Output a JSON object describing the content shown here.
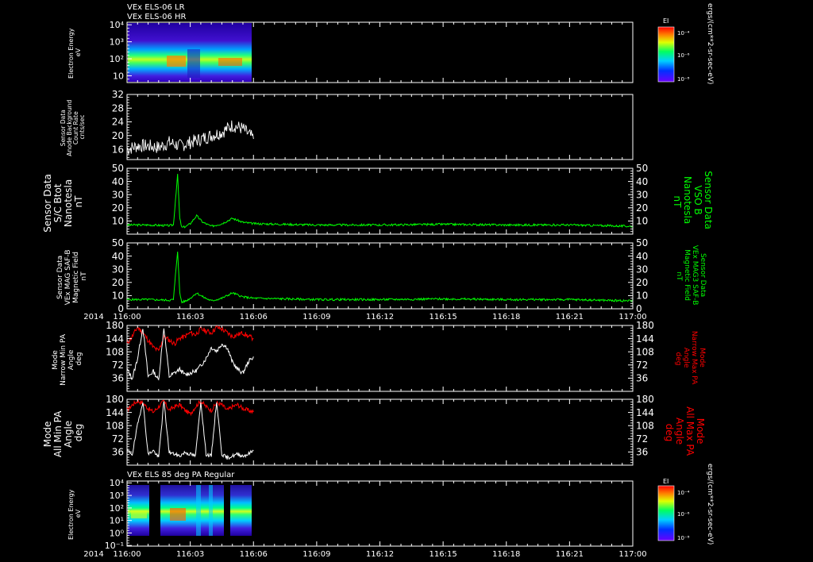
{
  "header": {
    "line1": "VEx ELS-06 LR",
    "line2": "VEx ELS-06 HR"
  },
  "x_axis": {
    "year": "2014",
    "ticks": [
      "116:00",
      "116:03",
      "116:06",
      "116:09",
      "116:12",
      "116:15",
      "116:18",
      "116:21",
      "117:00"
    ]
  },
  "colors": {
    "background": "#000000",
    "white": "#ffffff",
    "green": "#00ff00",
    "red": "#ff0000"
  },
  "colorbar": {
    "label": "EI",
    "units": "ergs/(cm**2-sr-sec-eV)",
    "ticks": [
      "10⁻⁴",
      "10⁻⁶",
      "10⁻⁸"
    ]
  },
  "panels": {
    "spec1": {
      "left_label": [
        "Electron Energy",
        "eV"
      ],
      "yticks": [
        {
          "v": 4,
          "t": "10⁴"
        },
        {
          "v": 3,
          "t": "10³"
        },
        {
          "v": 2,
          "t": "10²"
        },
        {
          "v": 1,
          "t": "10"
        }
      ]
    },
    "bg": {
      "left_label": [
        "Sensor Data",
        "Anode Background",
        "Count Rate",
        "cnts/sec"
      ],
      "yticks": [
        "32",
        "28",
        "24",
        "20",
        "16"
      ]
    },
    "btot": {
      "left_label": [
        "Sensor Data",
        "S/C Btot",
        "Nanotesla",
        "nT"
      ],
      "right_label": [
        "Sensor Data",
        "VSO B",
        "Nanotesla",
        "nT"
      ],
      "yticks": [
        "50",
        "40",
        "30",
        "20",
        "10"
      ],
      "ryticks": [
        "50",
        "40",
        "30",
        "20",
        "10"
      ]
    },
    "mag": {
      "left_label": [
        "Sensor Data",
        "VEx MAG SAF-B",
        "Magnetic Field",
        "nT"
      ],
      "right_label": [
        "Sensor Data",
        "VEx MAG3 SAF-B",
        "Magnetic Field",
        "nT"
      ],
      "yticks": [
        "50",
        "40",
        "30",
        "20",
        "10",
        "0"
      ],
      "ryticks": [
        "50",
        "40",
        "30",
        "20",
        "10",
        "0"
      ]
    },
    "pa1": {
      "left_label": [
        "Mode",
        "Narrow Min PA",
        "Angle",
        "deg"
      ],
      "right_label": [
        "Mode",
        "Narrow Max PA",
        "Angle",
        "deg"
      ],
      "yticks": [
        "180",
        "144",
        "108",
        "72",
        "36"
      ],
      "ryticks": [
        "180",
        "144",
        "108",
        "72",
        "36"
      ]
    },
    "pa2": {
      "left_label": [
        "Mode",
        "All Min PA",
        "Angle",
        "deg"
      ],
      "right_label": [
        "Mode",
        "All Max PA",
        "Angle",
        "deg"
      ],
      "yticks": [
        "180",
        "144",
        "108",
        "72",
        "36"
      ],
      "ryticks": [
        "180",
        "144",
        "108",
        "72",
        "36"
      ]
    },
    "spec2": {
      "title": "VEx ELS 85 deg PA Regular",
      "left_label": [
        "Electron Energy",
        "eV"
      ],
      "yticks": [
        {
          "v": 4,
          "t": "10⁴"
        },
        {
          "v": 3,
          "t": "10³"
        },
        {
          "v": 2,
          "t": "10²"
        },
        {
          "v": 1,
          "t": "10¹"
        },
        {
          "v": 0,
          "t": "10⁰"
        },
        {
          "v": -1,
          "t": "10⁻¹"
        }
      ]
    }
  },
  "chart_data": [
    {
      "type": "heatmap",
      "title": "VEx ELS-06 LR",
      "xlabel": "",
      "ylabel": "Electron Energy eV",
      "ylim_log10": [
        0.5,
        4.1
      ],
      "x_range_minutes": [
        0,
        6
      ],
      "peak_band_eV": [
        10,
        30
      ]
    },
    {
      "type": "line",
      "ylabel": "Sensor Data Anode Background Count Rate cnts/sec",
      "ylim": [
        13,
        32
      ],
      "x": [
        0,
        0.5,
        1,
        1.5,
        2,
        2.5,
        3,
        3.5,
        4,
        4.5,
        5,
        5.5,
        6
      ],
      "values": [
        16,
        17,
        17,
        16.5,
        18,
        17,
        18,
        19,
        20,
        21,
        23,
        22,
        19
      ]
    },
    {
      "type": "line",
      "ylabel": "Sensor Data S/C Btot Nanotesla nT",
      "ylim": [
        0,
        50
      ],
      "x": [
        0,
        1,
        2,
        2.2,
        2.4,
        2.5,
        2.6,
        2.8,
        3.0,
        3.3,
        3.6,
        4.0,
        4.5,
        5.0,
        5.5,
        6,
        9,
        12,
        15,
        18,
        21,
        24
      ],
      "values": [
        7,
        7,
        6.5,
        7,
        45,
        12,
        5,
        6,
        8,
        14,
        9,
        6,
        8,
        12,
        9,
        8,
        7,
        7,
        7.5,
        7,
        7,
        6
      ]
    },
    {
      "type": "line",
      "ylabel": "Sensor Data VEx MAG SAF-B Magnetic Field nT",
      "ylim": [
        0,
        50
      ],
      "x": [
        0,
        1,
        2,
        2.2,
        2.4,
        2.5,
        2.6,
        2.8,
        3.0,
        3.3,
        3.6,
        4.0,
        4.5,
        5.0,
        5.5,
        6,
        9,
        12,
        15,
        18,
        21,
        24
      ],
      "values": [
        7,
        7,
        6.5,
        7,
        44,
        12,
        5,
        6,
        8,
        12,
        9,
        6,
        8,
        12,
        9,
        8,
        7,
        7,
        7.5,
        7,
        7,
        6
      ]
    },
    {
      "type": "line",
      "ylabel": "Mode Narrow Min PA Angle deg",
      "ylim": [
        0,
        180
      ],
      "series": [
        {
          "values": [
            60,
            35,
            90,
            175,
            40,
            55,
            30,
            175,
            40,
            50,
            60,
            45,
            50,
            55,
            70,
            90,
            120,
            110,
            130,
            120,
            80,
            60,
            50,
            80,
            95
          ]
        },
        {
          "values": [
            130,
            150,
            175,
            160,
            140,
            120,
            110,
            150,
            140,
            130,
            145,
            150,
            160,
            155,
            170,
            165,
            160,
            175,
            170,
            160,
            150,
            155,
            160,
            150,
            145
          ]
        }
      ]
    },
    {
      "type": "line",
      "ylabel": "Mode All Min PA Angle deg",
      "ylim": [
        0,
        180
      ],
      "series": [
        {
          "values": [
            40,
            30,
            110,
            175,
            30,
            40,
            20,
            175,
            35,
            30,
            25,
            35,
            30,
            25,
            175,
            30,
            25,
            175,
            30,
            20,
            25,
            30,
            25,
            30,
            40
          ]
        },
        {
          "values": [
            150,
            165,
            175,
            170,
            155,
            145,
            160,
            175,
            150,
            160,
            165,
            150,
            140,
            160,
            175,
            160,
            150,
            170,
            165,
            150,
            160,
            165,
            155,
            150,
            145
          ]
        }
      ]
    },
    {
      "type": "heatmap",
      "title": "VEx ELS 85 deg PA Regular",
      "xlabel": "",
      "ylabel": "Electron Energy eV",
      "ylim_log10": [
        -1,
        4.1
      ],
      "x_range_minutes": [
        0,
        6
      ],
      "peak_band_eV": [
        5,
        20
      ]
    }
  ]
}
